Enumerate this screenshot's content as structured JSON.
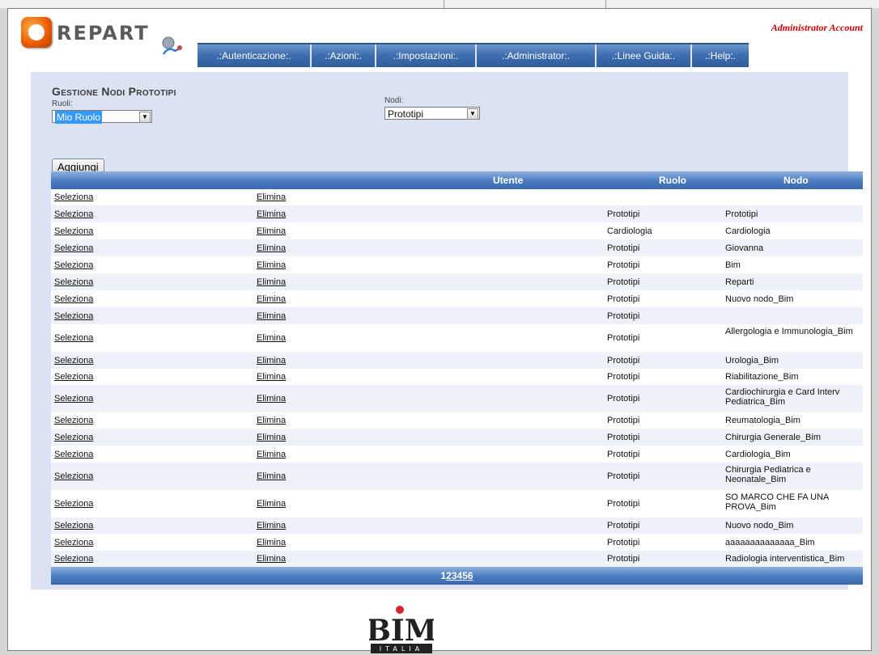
{
  "header": {
    "logo_text": "REPART",
    "account": "Administrator Account",
    "nav": [
      ".:Autenticazione:.",
      ".:Azioni:.",
      ".:Impostazioni:.",
      ".:Administrator:.",
      ".:Linee Guida:.",
      ".:Help:."
    ]
  },
  "page": {
    "title": "Gestione Nodi Prototipi",
    "ruoli_label": "Ruoli:",
    "ruoli_value": "Mio Ruolo",
    "nodi_label": "Nodi:",
    "nodi_value": "Prototipi",
    "add_button": "Aggiungi"
  },
  "grid": {
    "columns": [
      "Utente",
      "Ruolo",
      "Nodo"
    ],
    "select_label": "Seleziona",
    "delete_label": "Elimina",
    "rows": [
      {
        "ruolo": "",
        "nodo": "",
        "h": 20
      },
      {
        "ruolo": "Prototipi",
        "nodo": "Prototipi",
        "h": 21
      },
      {
        "ruolo": "Cardiologia",
        "nodo": "Cardiologia",
        "h": 21
      },
      {
        "ruolo": "Prototipi",
        "nodo": "Giovanna",
        "h": 21
      },
      {
        "ruolo": "Prototipi",
        "nodo": "Bim",
        "h": 21
      },
      {
        "ruolo": "Prototipi",
        "nodo": "Reparti",
        "h": 21
      },
      {
        "ruolo": "Prototipi",
        "nodo": "Nuovo nodo_Bim",
        "h": 21
      },
      {
        "ruolo": "Prototipi",
        "nodo": "",
        "h": 21
      },
      {
        "ruolo": "Prototipi",
        "nodo": "Allergologia e Immunologia_Bim",
        "h": 34
      },
      {
        "ruolo": "Prototipi",
        "nodo": "Urologia_Bim",
        "h": 21
      },
      {
        "ruolo": "Prototipi",
        "nodo": "Riabilitazione_Bim",
        "h": 20
      },
      {
        "ruolo": "Prototipi",
        "nodo": "Cardiochirurgia e Card Interv Pediatrica_Bim",
        "h": 34
      },
      {
        "ruolo": "Prototipi",
        "nodo": "Reumatologia_Bim",
        "h": 20
      },
      {
        "ruolo": "Prototipi",
        "nodo": "Chirurgia Generale_Bim",
        "h": 21
      },
      {
        "ruolo": "Prototipi",
        "nodo": "Cardiologia_Bim",
        "h": 21
      },
      {
        "ruolo": "Prototipi",
        "nodo": "Chirurgia Pediatrica e Neonatale_Bim",
        "h": 34
      },
      {
        "ruolo": "Prototipi",
        "nodo": "SO MARCO CHE FA UNA PROVA_Bim",
        "h": 34
      },
      {
        "ruolo": "Prototipi",
        "nodo": "Nuovo nodo_Bim",
        "h": 20
      },
      {
        "ruolo": "Prototipi",
        "nodo": "aaaaaaaaaaaaaa_Bim",
        "h": 21
      },
      {
        "ruolo": "Prototipi",
        "nodo": "Radiologia interventistica_Bim",
        "h": 20
      }
    ],
    "pages": [
      "1",
      "2",
      "3",
      "4",
      "5",
      "6"
    ],
    "current_page": "1"
  },
  "footer": {
    "logo_text": "BIM",
    "logo_sub": "ITALIA"
  }
}
